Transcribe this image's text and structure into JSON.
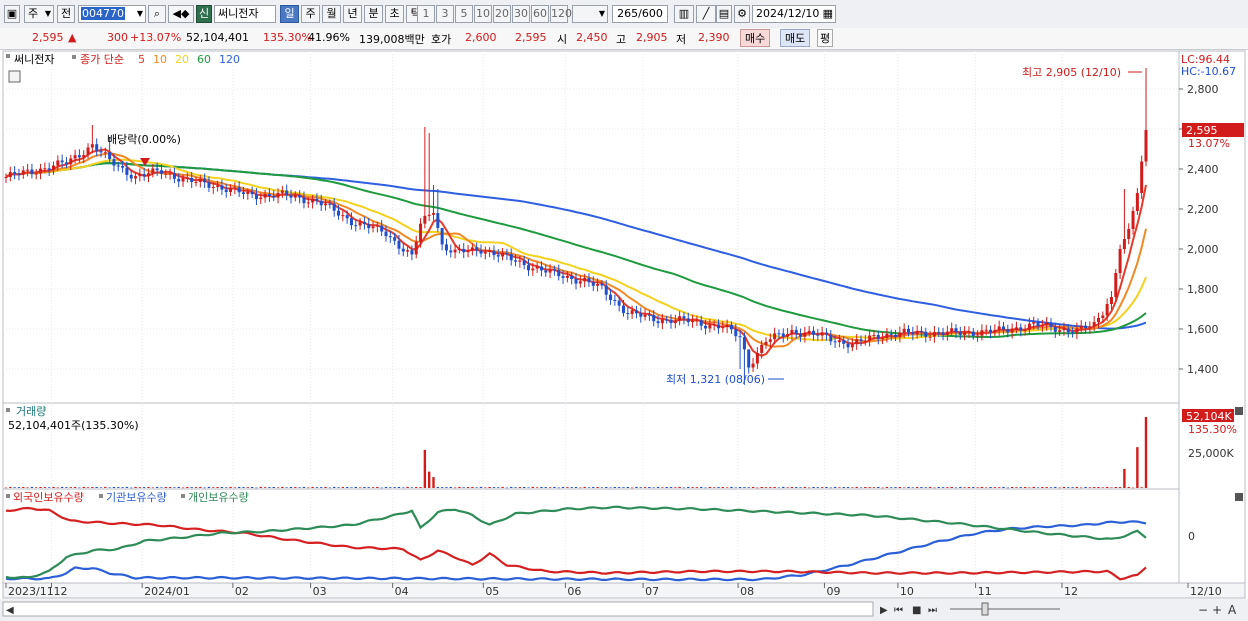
{
  "toolbar": {
    "market_select": "주",
    "prev_label": "전",
    "code": "004770",
    "badge": "신",
    "stock_name": "써니전자",
    "period_tabs": [
      "일",
      "주",
      "월",
      "년",
      "분",
      "초",
      "틱"
    ],
    "period_selected": "일",
    "interval_buttons": [
      "1",
      "3",
      "5",
      "10",
      "20",
      "30",
      "60",
      "120"
    ],
    "count": "265",
    "count_max": "/600",
    "date": "2024/12/10"
  },
  "quote": {
    "price": "2,595",
    "change": "300",
    "change_pct": "+13.07%",
    "volume": "52,104,401",
    "volume_ratio": "135.30%",
    "turnover": "41.96%",
    "amount": "139,008백만",
    "hoga_label": "호가",
    "ask": "2,600",
    "bid": "2,595",
    "open_label": "시",
    "open": "2,450",
    "high_label": "고",
    "high": "2,905",
    "low_label": "저",
    "low": "2,390",
    "buy_label": "매수",
    "sell_label": "매도",
    "eval_label": "평"
  },
  "colors": {
    "up": "#d21b1b",
    "down": "#1f4fcf",
    "ma5": "#e53b2c",
    "ma10": "#f08a24",
    "ma20": "#f2d21e",
    "ma60": "#1f9a3e",
    "ma120": "#2f5fe0",
    "foreign": "#d42020",
    "institution": "#2b5fd6",
    "individual": "#2e8b57"
  },
  "chart_data": [
    {
      "type": "candlestick",
      "title": "써니전자",
      "legend": [
        "종가 단순",
        "5",
        "10",
        "20",
        "60",
        "120"
      ],
      "ylim": [
        1250,
        2950
      ],
      "yticks": [
        1400,
        1600,
        1800,
        2000,
        2200,
        2400,
        2600,
        2800
      ],
      "ytick_labels": [
        "1,400",
        "1,600",
        "1,800",
        "2,000",
        "2,200",
        "2,400",
        "2,600",
        "2,800"
      ],
      "lc_label": "LC:96.44",
      "hc_label": "HC:-10.67",
      "last_price_label": "2,595",
      "last_change_label": "13.07%",
      "annotation_high": "최고 2,905 (12/10)",
      "annotation_low": "최저 1,321 (08/06)",
      "annotation_dividend": "배당락(0.00%)",
      "months": [
        {
          "label": "2023/11",
          "start": 0
        },
        {
          "label": "12",
          "start": 11
        },
        {
          "label": "2024/01",
          "start": 32
        },
        {
          "label": "02",
          "start": 53
        },
        {
          "label": "03",
          "start": 71
        },
        {
          "label": "04",
          "start": 90
        },
        {
          "label": "05",
          "start": 111
        },
        {
          "label": "06",
          "start": 130
        },
        {
          "label": "07",
          "start": 148
        },
        {
          "label": "08",
          "start": 170
        },
        {
          "label": "09",
          "start": 190
        },
        {
          "label": "10",
          "start": 207
        },
        {
          "label": "11",
          "start": 225
        },
        {
          "label": "12",
          "start": 245
        },
        {
          "label": "12/10",
          "start": null
        }
      ],
      "anchors": [
        [
          0,
          2360
        ],
        [
          8,
          2400
        ],
        [
          14,
          2430
        ],
        [
          20,
          2520
        ],
        [
          24,
          2440
        ],
        [
          30,
          2360
        ],
        [
          36,
          2390
        ],
        [
          42,
          2340
        ],
        [
          48,
          2320
        ],
        [
          56,
          2270
        ],
        [
          64,
          2270
        ],
        [
          72,
          2240
        ],
        [
          80,
          2140
        ],
        [
          88,
          2080
        ],
        [
          94,
          1960
        ],
        [
          96,
          2120
        ],
        [
          99,
          2200
        ],
        [
          101,
          2020
        ],
        [
          104,
          1980
        ],
        [
          110,
          2000
        ],
        [
          118,
          1940
        ],
        [
          126,
          1880
        ],
        [
          134,
          1840
        ],
        [
          138,
          1800
        ],
        [
          144,
          1680
        ],
        [
          150,
          1650
        ],
        [
          158,
          1640
        ],
        [
          166,
          1610
        ],
        [
          170,
          1560
        ],
        [
          172,
          1420
        ],
        [
          176,
          1540
        ],
        [
          182,
          1590
        ],
        [
          190,
          1560
        ],
        [
          196,
          1520
        ],
        [
          202,
          1570
        ],
        [
          210,
          1580
        ],
        [
          220,
          1580
        ],
        [
          230,
          1590
        ],
        [
          238,
          1620
        ],
        [
          248,
          1590
        ],
        [
          252,
          1620
        ],
        [
          256,
          1760
        ],
        [
          258,
          2000
        ],
        [
          260,
          2100
        ],
        [
          262,
          2280
        ],
        [
          264,
          2595
        ]
      ],
      "highs": [
        [
          20,
          2620
        ],
        [
          24,
          2560
        ],
        [
          97,
          2610
        ],
        [
          98,
          2580
        ],
        [
          99,
          2320
        ],
        [
          100,
          2300
        ],
        [
          101,
          2100
        ],
        [
          170,
          1400
        ],
        [
          171,
          1321
        ],
        [
          172,
          1430
        ],
        [
          257,
          1900
        ],
        [
          259,
          2300
        ],
        [
          264,
          2905
        ]
      ],
      "volume_panel": {
        "label": "거래량",
        "value_label": "52,104,401주(135.30%)",
        "ytick_label": "25,000K",
        "last_label": "52,104K",
        "last_pct": "135.30%",
        "spikes": [
          [
            97,
            28000
          ],
          [
            98,
            12000
          ],
          [
            99,
            8000
          ],
          [
            259,
            14000
          ],
          [
            262,
            30000
          ],
          [
            264,
            52104
          ]
        ]
      },
      "holdings_panel": {
        "legend": [
          "외국인보유수량",
          "기관보유수량",
          "개인보유수량"
        ],
        "ytick_label": "0",
        "foreign": [
          [
            0,
            0.12
          ],
          [
            6,
            0.09
          ],
          [
            10,
            0.12
          ],
          [
            15,
            0.25
          ],
          [
            25,
            0.28
          ],
          [
            35,
            0.3
          ],
          [
            45,
            0.36
          ],
          [
            55,
            0.4
          ],
          [
            65,
            0.48
          ],
          [
            80,
            0.58
          ],
          [
            92,
            0.6
          ],
          [
            96,
            0.74
          ],
          [
            100,
            0.62
          ],
          [
            104,
            0.7
          ],
          [
            108,
            0.8
          ],
          [
            112,
            0.66
          ],
          [
            116,
            0.8
          ],
          [
            125,
            0.88
          ],
          [
            140,
            0.9
          ],
          [
            160,
            0.88
          ],
          [
            180,
            0.88
          ],
          [
            200,
            0.9
          ],
          [
            220,
            0.9
          ],
          [
            240,
            0.89
          ],
          [
            255,
            0.88
          ],
          [
            258,
            0.97
          ],
          [
            262,
            0.93
          ],
          [
            264,
            0.82
          ]
        ],
        "institution": [
          [
            0,
            0.97
          ],
          [
            10,
            0.97
          ],
          [
            14,
            0.9
          ],
          [
            16,
            0.84
          ],
          [
            20,
            0.84
          ],
          [
            24,
            0.9
          ],
          [
            30,
            0.96
          ],
          [
            50,
            0.96
          ],
          [
            100,
            0.97
          ],
          [
            150,
            0.98
          ],
          [
            175,
            0.98
          ],
          [
            185,
            0.92
          ],
          [
            195,
            0.8
          ],
          [
            205,
            0.66
          ],
          [
            215,
            0.52
          ],
          [
            225,
            0.4
          ],
          [
            232,
            0.35
          ],
          [
            240,
            0.32
          ],
          [
            250,
            0.3
          ],
          [
            255,
            0.27
          ],
          [
            260,
            0.26
          ],
          [
            264,
            0.27
          ]
        ],
        "individual": [
          [
            0,
            0.95
          ],
          [
            5,
            0.96
          ],
          [
            10,
            0.88
          ],
          [
            14,
            0.7
          ],
          [
            20,
            0.62
          ],
          [
            26,
            0.6
          ],
          [
            32,
            0.5
          ],
          [
            40,
            0.46
          ],
          [
            50,
            0.4
          ],
          [
            60,
            0.38
          ],
          [
            70,
            0.34
          ],
          [
            80,
            0.3
          ],
          [
            90,
            0.18
          ],
          [
            94,
            0.12
          ],
          [
            96,
            0.34
          ],
          [
            100,
            0.14
          ],
          [
            104,
            0.1
          ],
          [
            108,
            0.18
          ],
          [
            112,
            0.3
          ],
          [
            118,
            0.16
          ],
          [
            130,
            0.1
          ],
          [
            140,
            0.08
          ],
          [
            160,
            0.1
          ],
          [
            180,
            0.14
          ],
          [
            200,
            0.18
          ],
          [
            220,
            0.28
          ],
          [
            240,
            0.4
          ],
          [
            250,
            0.45
          ],
          [
            256,
            0.48
          ],
          [
            260,
            0.42
          ],
          [
            262,
            0.38
          ],
          [
            264,
            0.45
          ]
        ]
      }
    }
  ]
}
